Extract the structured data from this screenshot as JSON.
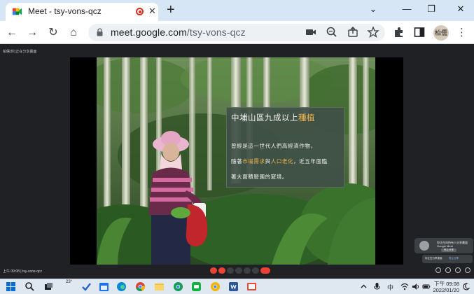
{
  "browser": {
    "tab": {
      "title": "Meet - tsy-vons-qcz",
      "close_label": "✕"
    },
    "new_tab_label": "+",
    "window_controls": {
      "dropdown": "⌄",
      "minimize": "—",
      "restore": "❐",
      "close": "✕"
    },
    "toolbar": {
      "back": "←",
      "forward": "→",
      "reload": "↻",
      "home": "⌂",
      "url_host": "meet.google.com",
      "url_path": "/tsy-vons-qcz",
      "profile_initials": "柏儒",
      "menu": "⋮"
    }
  },
  "meet": {
    "presenter_chip": "柏儒(你)正在分享畫面",
    "meeting_info": "上午 09:08  |  tsy-vons-qcz",
    "pip": {
      "text": "你正在向所有人分享畫面 Google Meet",
      "button": "停止分享"
    },
    "share_banner": {
      "text": "你正在分享畫面",
      "link": "停止分享"
    }
  },
  "slide": {
    "title_prefix": "中埔山區九成以上",
    "title_hl": "種植",
    "title_suffix": "",
    "line1": "曾經是這一世代人們高經濟作物，",
    "line2_prefix": "隨著",
    "line2_hl1": "市場需求",
    "line2_mid": "與",
    "line2_hl2": "人口老化",
    "line2_suffix": "，近五年面臨",
    "line3": "著大面積廢園的窘境。"
  },
  "taskbar": {
    "weather": "23°",
    "lang": "中",
    "time": "下午 09:08",
    "date": "2022/01/20"
  },
  "colors": {
    "tab_strip": "#d6e6f5",
    "meet_bg": "#202124",
    "highlight": "#f0b34a",
    "end_call": "#ea4335"
  }
}
